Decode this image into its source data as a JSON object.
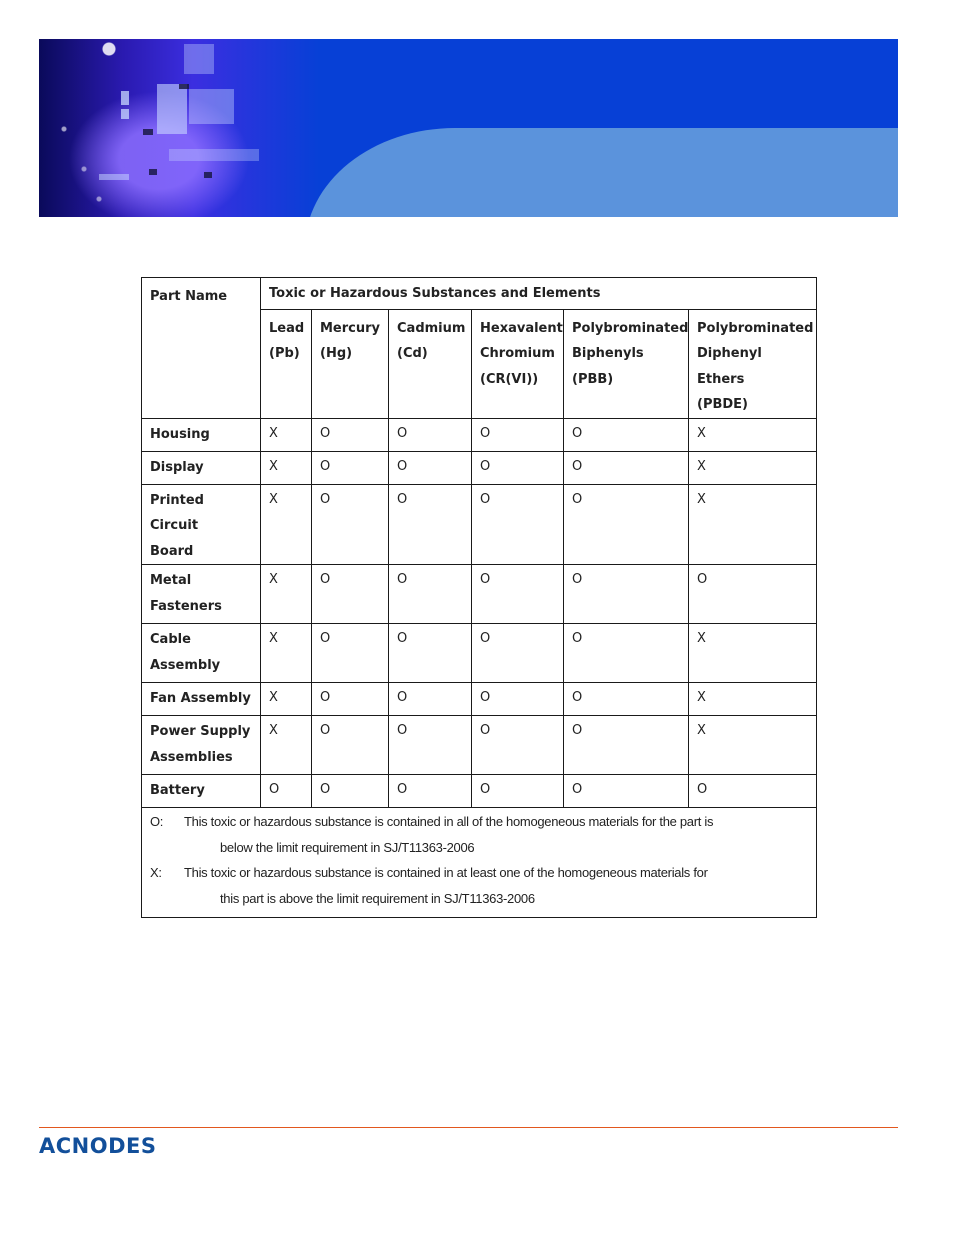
{
  "header": {
    "banner_colors": {
      "base": "#0740d6",
      "accent_shape": "#5b93dc"
    }
  },
  "table": {
    "part_name_header": "Part Name",
    "group_header": "Toxic or Hazardous Substances and Elements",
    "columns": [
      {
        "lines": [
          "Lead",
          "(Pb)"
        ]
      },
      {
        "lines": [
          "Mercury",
          "(Hg)"
        ]
      },
      {
        "lines": [
          "Cadmium",
          "(Cd)"
        ]
      },
      {
        "lines": [
          "Hexavalent",
          "Chromium",
          "(CR(VI))"
        ]
      },
      {
        "lines": [
          "Polybrominated",
          "Biphenyls",
          "(PBB)"
        ]
      },
      {
        "lines": [
          "Polybrominated",
          "Diphenyl",
          "Ethers",
          "(PBDE)"
        ]
      }
    ],
    "rows": [
      {
        "part": [
          "Housing"
        ],
        "values": [
          "X",
          "O",
          "O",
          "O",
          "O",
          "X"
        ]
      },
      {
        "part": [
          "Display"
        ],
        "values": [
          "X",
          "O",
          "O",
          "O",
          "O",
          "X"
        ]
      },
      {
        "part": [
          "Printed Circuit",
          "Board"
        ],
        "values": [
          "X",
          "O",
          "O",
          "O",
          "O",
          "X"
        ]
      },
      {
        "part": [
          "Metal",
          "Fasteners"
        ],
        "values": [
          "X",
          "O",
          "O",
          "O",
          "O",
          "O"
        ]
      },
      {
        "part": [
          "Cable",
          "Assembly"
        ],
        "values": [
          "X",
          "O",
          "O",
          "O",
          "O",
          "X"
        ]
      },
      {
        "part": [
          "Fan Assembly"
        ],
        "values": [
          "X",
          "O",
          "O",
          "O",
          "O",
          "X"
        ]
      },
      {
        "part": [
          "Power Supply",
          "Assemblies"
        ],
        "values": [
          "X",
          "O",
          "O",
          "O",
          "O",
          "X"
        ]
      },
      {
        "part": [
          "Battery"
        ],
        "values": [
          "O",
          "O",
          "O",
          "O",
          "O",
          "O"
        ]
      }
    ],
    "legend": [
      {
        "key": "O:",
        "text": "This toxic or hazardous  substance is contained  in all of the homogeneous  materials for the part is",
        "continuation": "below the limit requirement  in SJ/T11363-2006"
      },
      {
        "key": "X:",
        "text": "This toxic or hazardous  substance is contained in at least one of the homogeneous materials for",
        "continuation": "this part is above the limit requirement  in SJ/T11363-2006"
      }
    ]
  },
  "footer": {
    "logo_text": "ACNODES",
    "rule_color": "#e2571e",
    "logo_color": "#124f9a"
  }
}
